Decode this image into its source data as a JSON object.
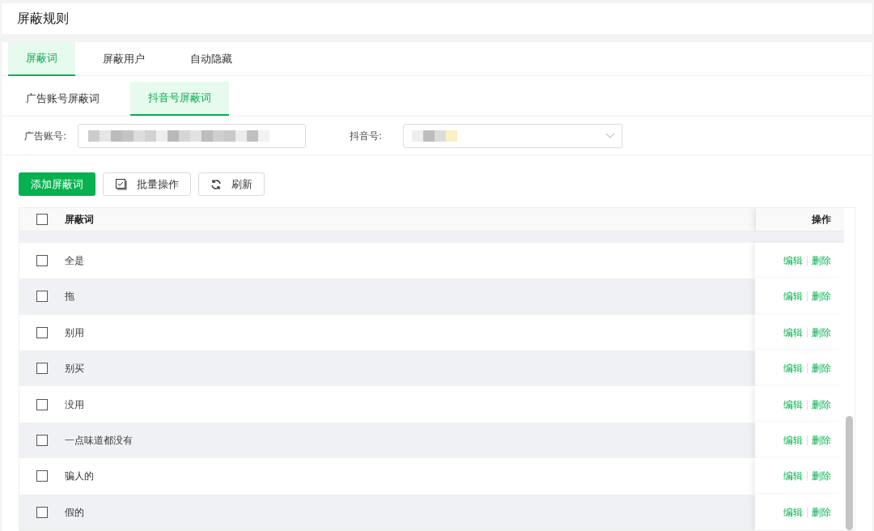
{
  "page_title": "屏蔽规则",
  "tabs": [
    {
      "label": "屏蔽词",
      "selected": true
    },
    {
      "label": "屏蔽用户",
      "selected": false
    },
    {
      "label": "自动隐藏",
      "selected": false
    }
  ],
  "sub_tabs": [
    {
      "label": "广告账号屏蔽词",
      "selected": false
    },
    {
      "label": "抖音号屏蔽词",
      "selected": true
    }
  ],
  "filters": [
    {
      "label": "广告账号:",
      "kind": "input"
    },
    {
      "label": "抖音号:",
      "kind": "select"
    }
  ],
  "buttons": [
    {
      "label": "添加屏蔽词",
      "kind": "primary"
    },
    {
      "label": "批量操作",
      "kind": "batch"
    },
    {
      "label": "刷新",
      "kind": "refresh"
    }
  ],
  "table": {
    "columns": [
      "屏蔽词",
      "操作"
    ],
    "header_checked": false,
    "rows": [
      {
        "word": "全是",
        "checked": false,
        "actions": [
          "编辑",
          "删除"
        ]
      },
      {
        "word": "拖",
        "checked": false,
        "actions": [
          "编辑",
          "删除"
        ]
      },
      {
        "word": "别用",
        "checked": false,
        "actions": [
          "编辑",
          "删除"
        ]
      },
      {
        "word": "别买",
        "checked": false,
        "actions": [
          "编辑",
          "删除"
        ]
      },
      {
        "word": "没用",
        "checked": false,
        "actions": [
          "编辑",
          "删除"
        ]
      },
      {
        "word": "一点味道都没有",
        "checked": false,
        "actions": [
          "编辑",
          "删除"
        ]
      },
      {
        "word": "骗人的",
        "checked": false,
        "actions": [
          "编辑",
          "删除"
        ]
      },
      {
        "word": "假的",
        "checked": false,
        "actions": [
          "编辑",
          "删除"
        ]
      }
    ]
  }
}
